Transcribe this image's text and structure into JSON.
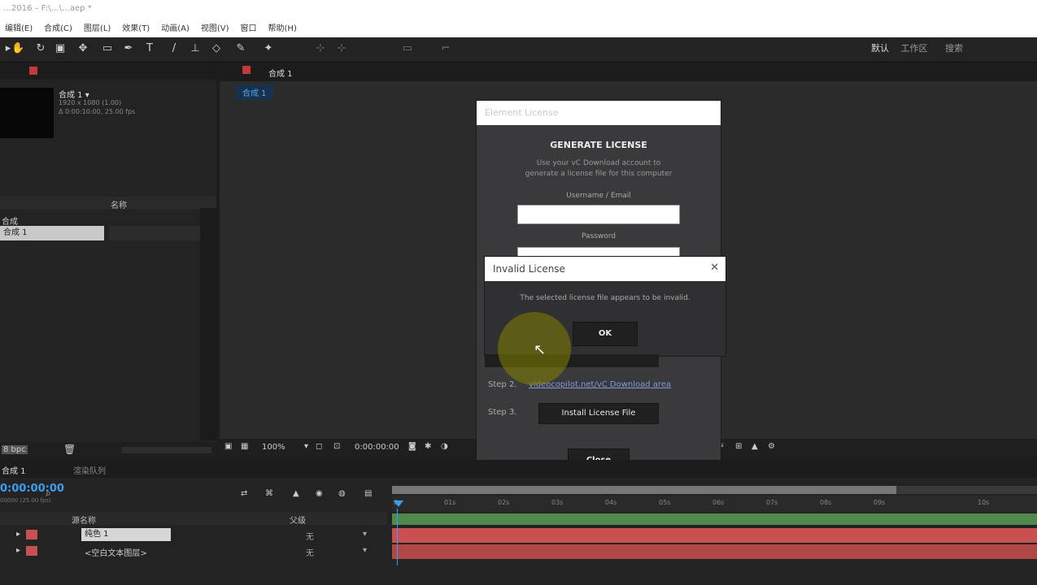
{
  "window": {
    "title": "…2016 – F:\\…\\…aep *"
  },
  "menu": [
    "编辑(E)",
    "合成(C)",
    "图层(L)",
    "效果(T)",
    "动画(A)",
    "视图(V)",
    "窗口",
    "帮助(H)"
  ],
  "toolbar": {
    "workspace_labels": [
      "默认",
      "工作区",
      "搜索"
    ]
  },
  "project": {
    "comp_name": "合成 1 ▾",
    "comp_info_1": "1920 x 1080 (1.00)",
    "comp_info_2": "Δ 0:00:10:00, 25.00 fps",
    "list_header": "名称",
    "folder": "合成",
    "item_selected": "合成 1",
    "footer_bpc": "8 bpc"
  },
  "viewer": {
    "tab_label": "合成 1",
    "comp_tab": "合成 1",
    "zoom": "100%",
    "timecode": "0:00:00:00"
  },
  "generate_dialog": {
    "title": "Element License",
    "heading": "GENERATE LICENSE",
    "desc_1": "Use your vC Download account to",
    "desc_2": "generate a license file for this computer",
    "username_label": "Username / Email",
    "password_label": "Password",
    "step2_label": "Step 2.",
    "step2_link": "videocopilot.net/vC Download area",
    "step3_label": "Step 3.",
    "step3_button": "Install License File",
    "close_button": "Close"
  },
  "invalid_dialog": {
    "title": "Invalid License",
    "message": "The selected license file appears to be invalid.",
    "ok_button": "OK"
  },
  "timeline": {
    "tab_comp": "合成 1",
    "tab_render": "渲染队列",
    "timecode": "0:00:00:00",
    "fps_sub": "00000 (25.00 fps)",
    "col_source": "源名称",
    "col_parent": "父级",
    "layer1": "纯色 1",
    "layer2": "<空白文本图层>",
    "layer1_parent": "无",
    "layer2_parent": "无",
    "ruler_ticks": [
      "0s",
      "01s",
      "02s",
      "03s",
      "04s",
      "05s",
      "06s",
      "07s",
      "08s",
      "09s",
      "10s"
    ]
  },
  "colors": {
    "accent_blue": "#2d8ceb",
    "layer_red": "#c85050",
    "work_area_green": "#4f8a4c"
  }
}
